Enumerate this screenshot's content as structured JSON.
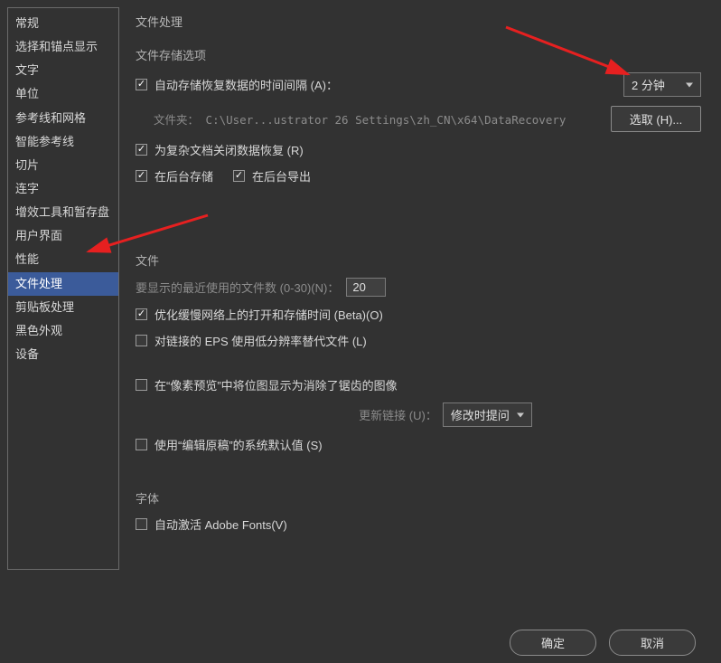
{
  "sidebar": {
    "items": [
      {
        "label": "常规"
      },
      {
        "label": "选择和锚点显示"
      },
      {
        "label": "文字"
      },
      {
        "label": "单位"
      },
      {
        "label": "参考线和网格"
      },
      {
        "label": "智能参考线"
      },
      {
        "label": "切片"
      },
      {
        "label": "连字"
      },
      {
        "label": "增效工具和暂存盘"
      },
      {
        "label": "用户界面"
      },
      {
        "label": "性能"
      },
      {
        "label": "文件处理"
      },
      {
        "label": "剪贴板处理"
      },
      {
        "label": "黑色外观"
      },
      {
        "label": "设备"
      }
    ],
    "selected_index": 11
  },
  "panel": {
    "title": "文件处理",
    "storage": {
      "title": "文件存储选项",
      "auto_save_label": "自动存储恢复数据的时间间隔 (A)：",
      "auto_save_checked": true,
      "interval_value": "2 分钟",
      "folder_label": "文件夹：",
      "folder_path": "C:\\User...ustrator 26 Settings\\zh_CN\\x64\\DataRecovery",
      "choose_btn": "选取 (H)...",
      "close_recovery_label": "为复杂文档关闭数据恢复 (R)",
      "close_recovery_checked": true,
      "bg_save_label": "在后台存储",
      "bg_save_checked": true,
      "bg_export_label": "在后台导出",
      "bg_export_checked": true
    },
    "files": {
      "title": "文件",
      "recent_label": "要显示的最近使用的文件数 (0-30)(N)：",
      "recent_value": "20",
      "optimize_label": "优化缓慢网络上的打开和存储时间 (Beta)(O)",
      "optimize_checked": true,
      "eps_label": "对链接的 EPS 使用低分辨率替代文件 (L)",
      "eps_checked": false,
      "pixel_preview_label": "在“像素预览”中将位图显示为消除了锯齿的图像",
      "pixel_preview_checked": false,
      "update_links_label": "更新链接 (U)：",
      "update_links_value": "修改时提问",
      "edit_original_label": "使用“编辑原稿”的系统默认值 (S)",
      "edit_original_checked": false
    },
    "fonts": {
      "title": "字体",
      "auto_activate_label": "自动激活 Adobe Fonts(V)",
      "auto_activate_checked": false
    }
  },
  "footer": {
    "ok": "确定",
    "cancel": "取消"
  }
}
